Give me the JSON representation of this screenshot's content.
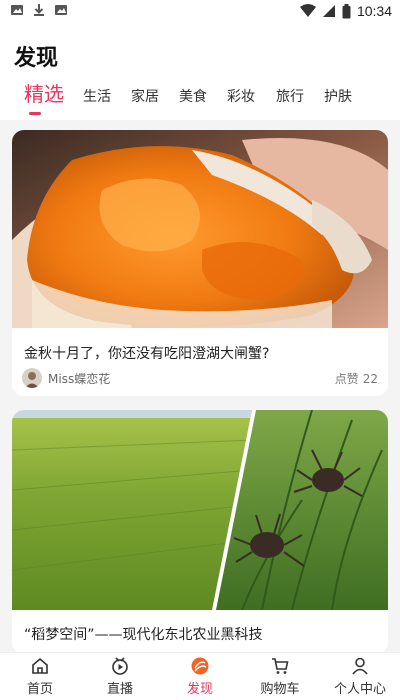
{
  "status_bar": {
    "time": "10:34",
    "left_icons": [
      "image-icon",
      "download-icon",
      "image-icon"
    ],
    "right_icons": [
      "wifi-icon",
      "signal-icon",
      "battery-icon"
    ]
  },
  "header": {
    "title": "发现",
    "tabs": [
      {
        "label": "精选",
        "active": true
      },
      {
        "label": "生活"
      },
      {
        "label": "家居"
      },
      {
        "label": "美食"
      },
      {
        "label": "彩妆"
      },
      {
        "label": "旅行"
      },
      {
        "label": "护肤"
      }
    ]
  },
  "feed": [
    {
      "title": "金秋十月了，你还没有吃阳澄湖大闸蟹?",
      "author": "Miss蝶恋花",
      "likes_label": "点赞",
      "likes": "22"
    },
    {
      "title": "“稻梦空间”——现代化东北农业黑科技"
    }
  ],
  "bottom_nav": [
    {
      "label": "首页",
      "icon": "home-icon"
    },
    {
      "label": "直播",
      "icon": "live-icon"
    },
    {
      "label": "发现",
      "icon": "discover-icon",
      "active": true
    },
    {
      "label": "购物车",
      "icon": "cart-icon"
    },
    {
      "label": "个人中心",
      "icon": "person-icon"
    }
  ],
  "colors": {
    "accent": "#e8365d"
  }
}
